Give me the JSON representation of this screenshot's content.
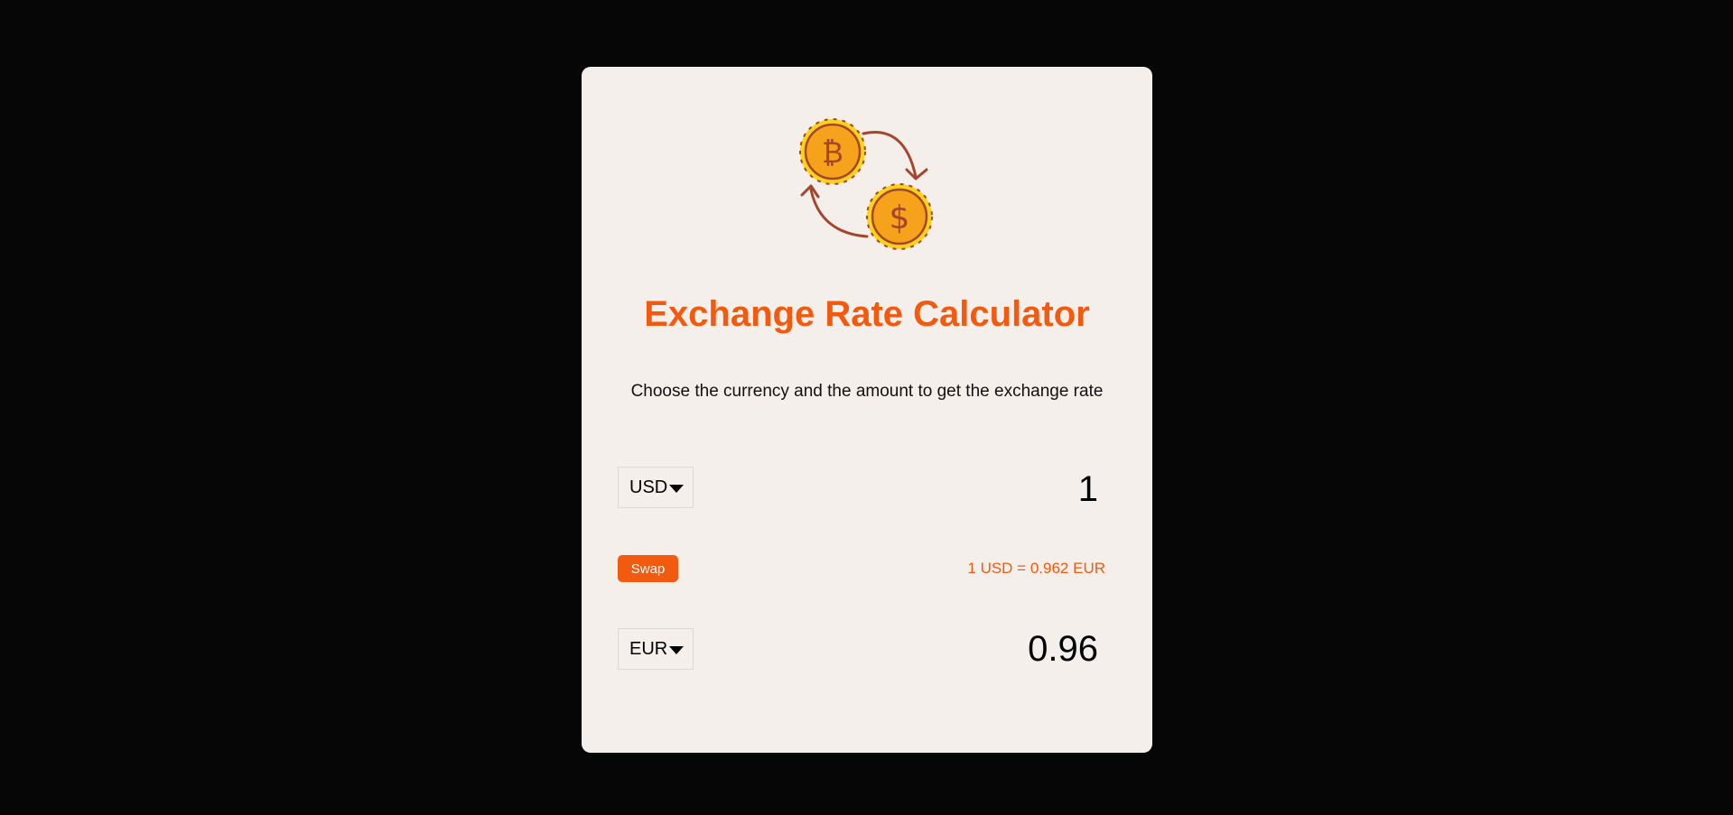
{
  "app": {
    "title": "Exchange Rate Calculator",
    "subtitle": "Choose the currency and the amount to get the exchange rate"
  },
  "icons": {
    "logo": "bitcoin-dollar-exchange-icon",
    "dropdown": "caret-down-icon"
  },
  "from": {
    "currency": "USD",
    "amount": "1"
  },
  "swap": {
    "label": "Swap"
  },
  "rate": {
    "text": "1 USD = 0.962 EUR"
  },
  "to": {
    "currency": "EUR",
    "amount": "0.96"
  },
  "colors": {
    "accent": "#f25a0f",
    "background": "#060606",
    "card": "#f4efeb",
    "coin": "#f7a21b",
    "coin_rim": "#fcd21b",
    "arrow": "#a4462c"
  }
}
